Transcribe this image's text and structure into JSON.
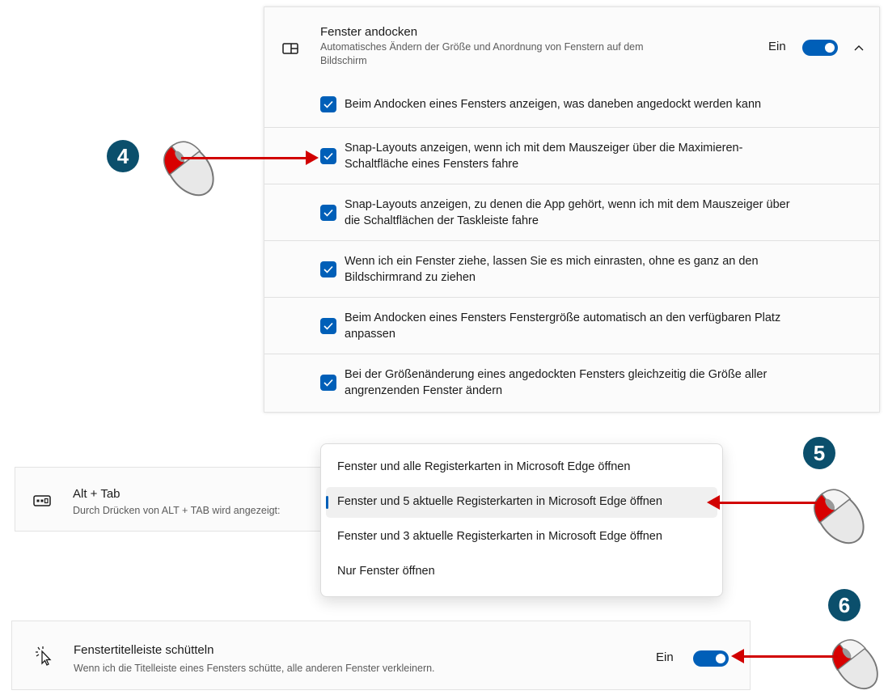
{
  "snap": {
    "title": "Fenster andocken",
    "description": "Automatisches Ändern der Größe und Anordnung von Fenstern auf dem Bildschirm",
    "toggle_label": "Ein",
    "toggle_state": "on",
    "expanded": true,
    "options": [
      {
        "label": "Beim Andocken eines Fensters anzeigen, was daneben angedockt werden kann",
        "checked": true
      },
      {
        "label": "Snap-Layouts anzeigen, wenn ich mit dem Mauszeiger über die Maximieren-Schaltfläche eines Fensters fahre",
        "checked": true
      },
      {
        "label": "Snap-Layouts anzeigen, zu denen die App gehört, wenn ich mit dem Mauszeiger über die Schaltflächen der Taskleiste fahre",
        "checked": true
      },
      {
        "label": "Wenn ich ein Fenster ziehe, lassen Sie es mich einrasten, ohne es ganz an den Bildschirmrand zu ziehen",
        "checked": true
      },
      {
        "label": "Beim Andocken eines Fensters Fenstergröße automatisch an den verfügbaren Platz anpassen",
        "checked": true
      },
      {
        "label": "Bei der Größenänderung eines angedockten Fensters gleichzeitig die Größe aller angrenzenden Fenster ändern",
        "checked": true
      }
    ]
  },
  "alttab": {
    "title": "Alt + Tab",
    "description": "Durch Drücken von ALT + TAB wird angezeigt:",
    "options": [
      "Fenster und alle Registerkarten in Microsoft Edge öffnen",
      "Fenster und 5 aktuelle Registerkarten in Microsoft Edge öffnen",
      "Fenster und 3 aktuelle Registerkarten in Microsoft Edge öffnen",
      "Nur Fenster öffnen"
    ],
    "selected": "Fenster und 5 aktuelle Registerkarten in Microsoft Edge öffnen"
  },
  "shake": {
    "title": "Fenstertitelleiste schütteln",
    "description": "Wenn ich die Titelleiste eines Fensters schütte, alle anderen Fenster verkleinern.",
    "toggle_label": "Ein",
    "toggle_state": "on"
  },
  "annotations": {
    "step4": "4",
    "step5": "5",
    "step6": "6"
  },
  "colors": {
    "accent": "#005fb8",
    "badge": "#0b4f6c",
    "arrow": "#d10000"
  },
  "icons": [
    "snap-window-icon",
    "chevron-up-icon",
    "checkmark-icon",
    "alt-tab-icon",
    "shake-cursor-icon",
    "mouse-icon"
  ]
}
